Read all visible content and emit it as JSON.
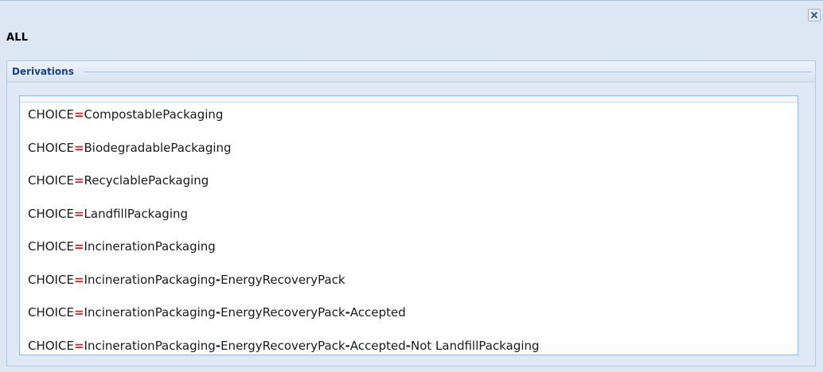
{
  "window": {
    "title": "ALL",
    "close_icon": "close-icon"
  },
  "fieldset": {
    "legend": "Derivations"
  },
  "colors": {
    "operator": "#e02020",
    "legend_text": "#15428b",
    "panel_bg": "#dde7f3"
  },
  "derivations": [
    {
      "key": "CHOICE",
      "op": "=",
      "parts": [
        "CompostablePackaging"
      ]
    },
    {
      "key": "CHOICE",
      "op": "=",
      "parts": [
        "BiodegradablePackaging"
      ]
    },
    {
      "key": "CHOICE",
      "op": "=",
      "parts": [
        "RecyclablePackaging"
      ]
    },
    {
      "key": "CHOICE",
      "op": "=",
      "parts": [
        "LandfillPackaging"
      ]
    },
    {
      "key": "CHOICE",
      "op": "=",
      "parts": [
        "IncinerationPackaging"
      ]
    },
    {
      "key": "CHOICE",
      "op": "=",
      "parts": [
        "IncinerationPackaging",
        "EnergyRecoveryPack"
      ]
    },
    {
      "key": "CHOICE",
      "op": "=",
      "parts": [
        "IncinerationPackaging",
        "EnergyRecoveryPack",
        "Accepted"
      ]
    },
    {
      "key": "CHOICE",
      "op": "=",
      "parts": [
        "IncinerationPackaging",
        "EnergyRecoveryPack",
        "Accepted",
        "Not LandfillPackaging"
      ]
    }
  ],
  "separator": "-"
}
